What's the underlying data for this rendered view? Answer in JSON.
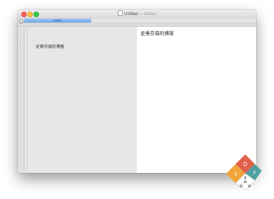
{
  "window": {
    "title": "Untitled",
    "title_separator": " — ",
    "status": "Edited"
  },
  "tabs": [
    {
      "label": "Untitled",
      "active": true
    }
  ],
  "editor": {
    "text": "史蒂芬周的博客"
  },
  "preview": {
    "text": "史蒂芬周的博客"
  },
  "watermark": {
    "letters": [
      "D",
      "F",
      "S",
      "Z",
      "H",
      "O",
      "U"
    ]
  },
  "colors": {
    "tab_active": "#7faee9",
    "editor_bg": "#e7e7e7",
    "preview_bg": "#ffffff",
    "logo_red": "#e0614a",
    "logo_orange": "#f0a43a",
    "logo_teal": "#4f9fa0"
  }
}
